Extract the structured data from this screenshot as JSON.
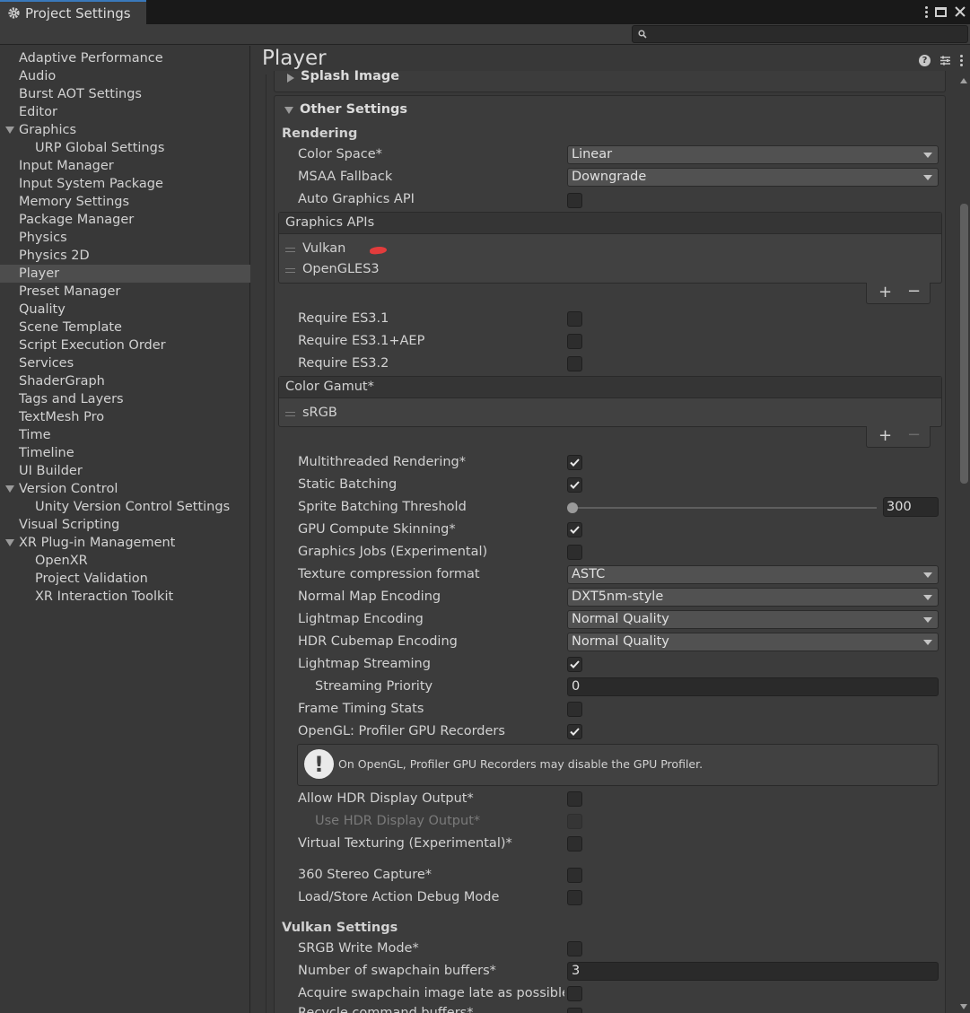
{
  "window": {
    "tab_title": "Project Settings"
  },
  "search": {
    "placeholder": ""
  },
  "sidebar": {
    "items": [
      "Adaptive Performance",
      "Audio",
      "Burst AOT Settings",
      "Editor",
      "Graphics",
      "URP Global Settings",
      "Input Manager",
      "Input System Package",
      "Memory Settings",
      "Package Manager",
      "Physics",
      "Physics 2D",
      "Player",
      "Preset Manager",
      "Quality",
      "Scene Template",
      "Script Execution Order",
      "Services",
      "ShaderGraph",
      "Tags and Layers",
      "TextMesh Pro",
      "Time",
      "Timeline",
      "UI Builder",
      "Version Control",
      "Unity Version Control Settings",
      "Visual Scripting",
      "XR Plug-in Management",
      "OpenXR",
      "Project Validation",
      "XR Interaction Toolkit"
    ],
    "selected": "Player"
  },
  "page": {
    "title": "Player"
  },
  "sections": {
    "splash": "Splash Image",
    "other": "Other Settings",
    "rendering": "Rendering",
    "vulkan": "Vulkan Settings"
  },
  "rendering": {
    "color_space_label": "Color Space*",
    "color_space_value": "Linear",
    "msaa_label": "MSAA Fallback",
    "msaa_value": "Downgrade",
    "auto_gfx_label": "Auto Graphics API",
    "graphics_apis_header": "Graphics APIs",
    "graphics_apis": [
      "Vulkan",
      "OpenGLES3"
    ],
    "req_es31": "Require ES3.1",
    "req_es31aep": "Require ES3.1+AEP",
    "req_es32": "Require ES3.2",
    "color_gamut_header": "Color Gamut*",
    "color_gamut": [
      "sRGB"
    ],
    "mt_rendering": "Multithreaded Rendering*",
    "static_batching": "Static Batching",
    "sprite_threshold_label": "Sprite Batching Threshold",
    "sprite_threshold_value": "300",
    "gpu_skinning": "GPU Compute Skinning*",
    "graphics_jobs": "Graphics Jobs (Experimental)",
    "tex_compression_label": "Texture compression format",
    "tex_compression_value": "ASTC",
    "normal_map_label": "Normal Map Encoding",
    "normal_map_value": "DXT5nm-style",
    "lightmap_enc_label": "Lightmap Encoding",
    "lightmap_enc_value": "Normal Quality",
    "hdr_cubemap_label": "HDR Cubemap Encoding",
    "hdr_cubemap_value": "Normal Quality",
    "lightmap_streaming": "Lightmap Streaming",
    "streaming_priority_label": "Streaming Priority",
    "streaming_priority_value": "0",
    "frame_timing": "Frame Timing Stats",
    "opengl_profiler": "OpenGL: Profiler GPU Recorders",
    "help_msg": "On OpenGL, Profiler GPU Recorders may disable the GPU Profiler.",
    "allow_hdr": "Allow HDR Display Output*",
    "use_hdr": "Use HDR Display Output*",
    "virtual_tex": "Virtual Texturing (Experimental)*",
    "stereo_capture": "360 Stereo Capture*",
    "load_store_debug": "Load/Store Action Debug Mode"
  },
  "vulkan": {
    "srgb_write": "SRGB Write Mode*",
    "swapchain_label": "Number of swapchain buffers*",
    "swapchain_value": "3",
    "acquire_late": "Acquire swapchain image late as possible*",
    "recycle_buffers": "Recycle command buffers*"
  },
  "checkboxes": {
    "auto_gfx": false,
    "req_es31": false,
    "req_es31aep": false,
    "req_es32": false,
    "mt_rendering": true,
    "static_batching": true,
    "gpu_skinning": true,
    "graphics_jobs": false,
    "lightmap_streaming": true,
    "frame_timing": false,
    "opengl_profiler": true,
    "allow_hdr": false,
    "use_hdr": false,
    "virtual_tex": false,
    "stereo_capture": false,
    "load_store_debug": false,
    "srgb_write": false,
    "acquire_late": false
  },
  "slider": {
    "sprite_threshold_fraction": 0.0
  },
  "icons": [
    "gear-icon",
    "search-icon",
    "help-icon",
    "preset-icon",
    "more-icon",
    "close-icon",
    "maximize-icon",
    "warning-icon",
    "checkmark-icon"
  ]
}
